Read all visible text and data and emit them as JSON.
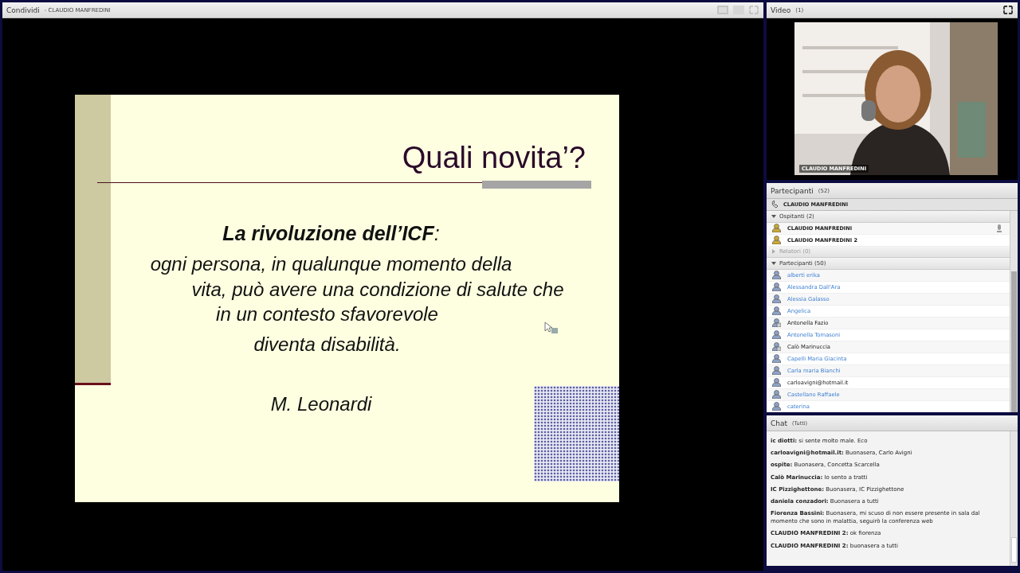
{
  "share_pod": {
    "title": "Condividi",
    "presenter": "- CLAUDIO MANFREDINI",
    "slide": {
      "title": "Quali novita’?",
      "heading": "**La rivoluzione dell’ICF**:",
      "lines": [
        "ogni persona, in qualunque momento della",
        "vita, può avere una condizione di salute che",
        "in un contesto sfavorevole",
        "diventa disabilità."
      ],
      "author": "M. Leonardi"
    }
  },
  "video_pod": {
    "title": "Video",
    "count": "(1)",
    "caption": "CLAUDIO MANFREDINI"
  },
  "participants_pod": {
    "title": "Partecipanti",
    "count": "(52)",
    "phone_user": "CLAUDIO MANFREDINI",
    "groups": [
      {
        "label": "Ospitanti (2)",
        "expanded": true,
        "members": [
          {
            "name": "CLAUDIO MANFREDINI",
            "kind": "host",
            "speaking": true
          },
          {
            "name": "CLAUDIO MANFREDINI 2",
            "kind": "host",
            "speaking": false
          }
        ]
      },
      {
        "label": "Relatori (0)",
        "expanded": false
      },
      {
        "label": "Partecipanti (50)",
        "expanded": true,
        "members": [
          {
            "name": "alberti erika",
            "kind": "guest",
            "speaking": false
          },
          {
            "name": "Alessandra Dall'Ara",
            "kind": "guest",
            "speaking": false
          },
          {
            "name": "Alessia Galasso",
            "kind": "guest",
            "speaking": false
          },
          {
            "name": "Angelica",
            "kind": "guest",
            "speaking": false
          },
          {
            "name": "Antonella Fazio",
            "kind": "user",
            "speaking": false
          },
          {
            "name": "Antonella Tomasoni",
            "kind": "guest",
            "speaking": false
          },
          {
            "name": "Calò Marinuccia",
            "kind": "user",
            "speaking": false
          },
          {
            "name": "Capelli Maria Giacinta",
            "kind": "guest",
            "speaking": false
          },
          {
            "name": "Carla maria Bianchi",
            "kind": "guest",
            "speaking": false
          },
          {
            "name": "carloavigni@hotmail.it",
            "kind": "member",
            "speaking": false
          },
          {
            "name": "Castellano Raffaele",
            "kind": "guest",
            "speaking": false
          },
          {
            "name": "caterina",
            "kind": "guest",
            "speaking": false
          }
        ]
      }
    ]
  },
  "chat_pod": {
    "title": "Chat",
    "audience": "(Tutti)",
    "messages": [
      {
        "sender": "ic diotti:",
        "text": "si sente molto male. Eco"
      },
      {
        "sender": "carloavigni@hotmail.it:",
        "text": "Buonasera, Carlo Avigni"
      },
      {
        "sender": "ospite:",
        "text": "Buonasera, Concetta Scarcella"
      },
      {
        "sender": "Calò Marinuccia:",
        "text": "Io sento a tratti"
      },
      {
        "sender": "IC Pizzighettone:",
        "text": "Buonasera, IC Pizzighettone"
      },
      {
        "sender": "daniela conzadori:",
        "text": "Buonasera a tutti"
      },
      {
        "sender": "Fiorenza Bassini:",
        "text": "Buonasera, mi scuso di non essere presente in sala dal momento che sono in malattia, seguirò la conferenza web"
      },
      {
        "sender": "CLAUDIO MANFREDINI 2:",
        "text": "ok fiorenza"
      },
      {
        "sender": "CLAUDIO MANFREDINI 2:",
        "text": "buonasera a tutti"
      }
    ]
  }
}
